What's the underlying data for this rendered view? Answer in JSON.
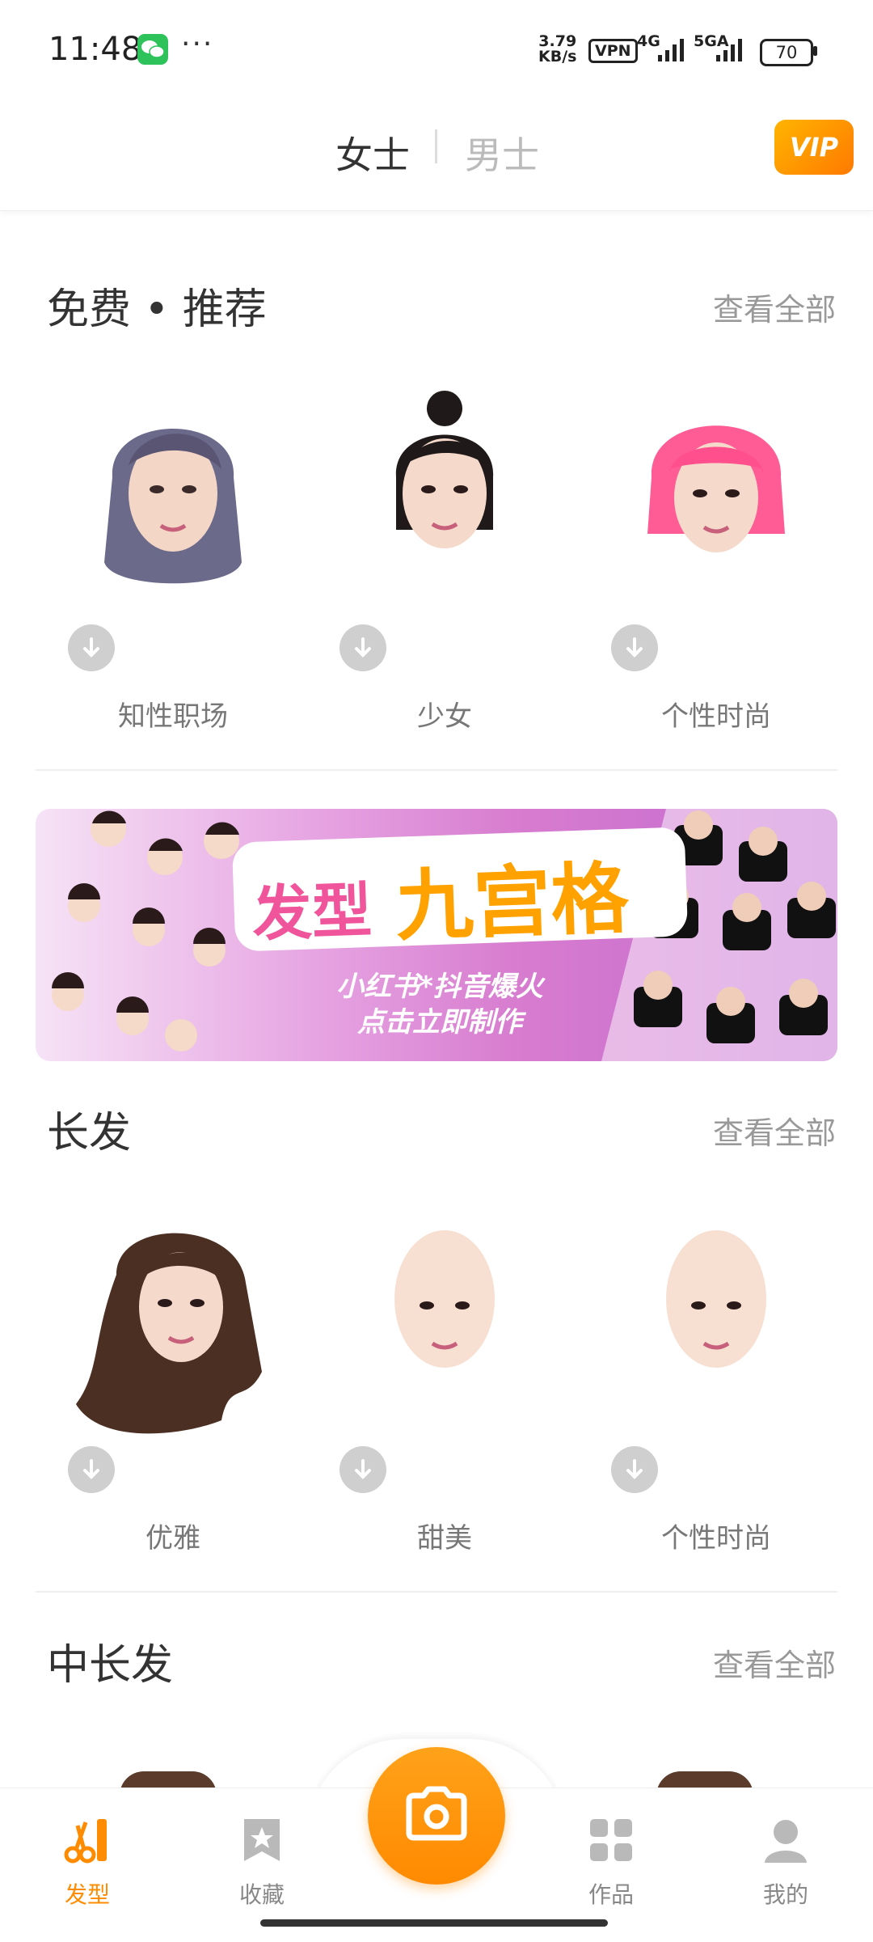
{
  "status_bar": {
    "time": "11:48",
    "more": "···",
    "speed_value": "3.79",
    "speed_unit": "KB/s",
    "vpn": "VPN",
    "net1": "4G",
    "net2": "5GA",
    "battery": "70"
  },
  "header": {
    "tab_women": "女士",
    "tab_men": "男士",
    "vip": "VIP"
  },
  "sections": {
    "recommend": {
      "title": "免费 • 推荐",
      "view_all": "查看全部",
      "items": [
        {
          "label": "知性职场",
          "hair_color": "#6b6a8a"
        },
        {
          "label": "少女",
          "hair_color": "#1f1a19"
        },
        {
          "label": "个性时尚",
          "hair_color": "#ff5c96"
        }
      ]
    },
    "long_hair": {
      "title": "长发",
      "view_all": "查看全部",
      "items": [
        {
          "label": "优雅",
          "hair_color": "#4a2f22"
        },
        {
          "label": "甜美",
          "hair_color": "none"
        },
        {
          "label": "个性时尚",
          "hair_color": "none"
        }
      ]
    },
    "medium_hair": {
      "title": "中长发",
      "view_all": "查看全部"
    }
  },
  "banner": {
    "title_small": "发型",
    "title_big": "九宫格",
    "subtitle_line1": "小红书*抖音爆火",
    "subtitle_line2": "点击立即制作"
  },
  "bottom_nav": {
    "items": [
      {
        "label": "发型",
        "icon": "scissors-comb-icon",
        "active": true
      },
      {
        "label": "收藏",
        "icon": "bookmark-star-icon",
        "active": false
      },
      {
        "label": "作品",
        "icon": "grid-icon",
        "active": false
      },
      {
        "label": "我的",
        "icon": "person-icon",
        "active": false
      }
    ],
    "camera_icon": "camera-icon"
  },
  "colors": {
    "accent": "#ff8c00",
    "text": "#333333",
    "muted": "#999999"
  }
}
